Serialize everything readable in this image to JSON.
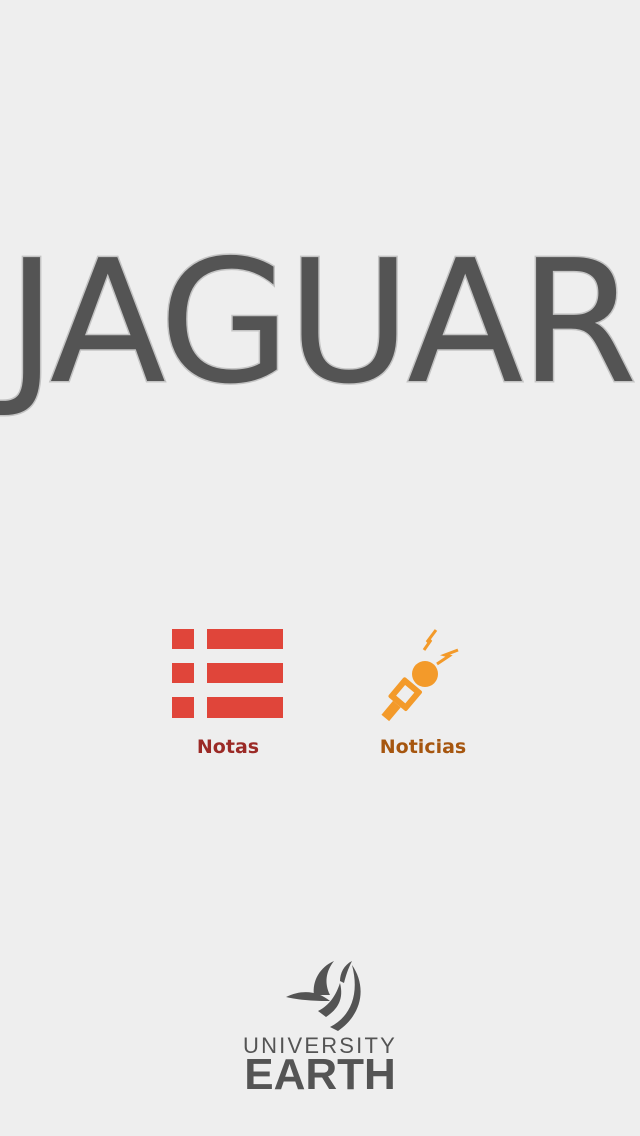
{
  "app": {
    "title": "JAGUAR"
  },
  "menu": {
    "items": [
      {
        "label": "Notas",
        "icon": "list-icon",
        "color": "#e0453a"
      },
      {
        "label": "Noticias",
        "icon": "microphone-icon",
        "color": "#f39a2a"
      }
    ]
  },
  "footer": {
    "logo_line1": "UNIVERSITY",
    "logo_line2": "EARTH",
    "logo_icon": "leaf-logo-icon"
  },
  "colors": {
    "background": "#eeeeee",
    "title": "#545454",
    "notas_label": "#9b2a26",
    "noticias_label": "#a6560f"
  }
}
